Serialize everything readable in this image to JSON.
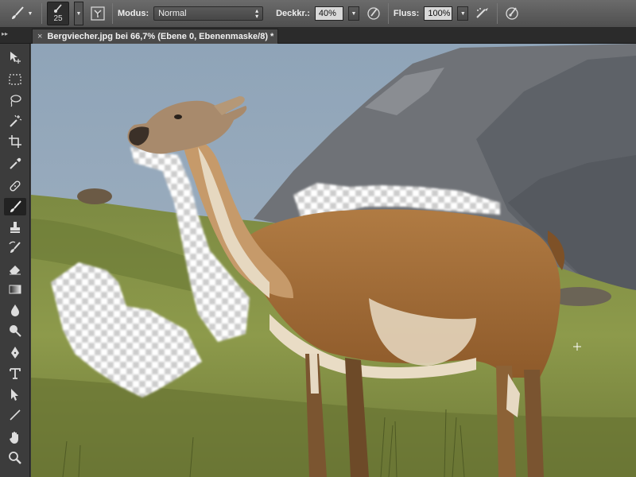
{
  "options_bar": {
    "brush_size": "25",
    "mode_label": "Modus:",
    "mode_value": "Normal",
    "opacity_label": "Deckkr.:",
    "opacity_value": "40%",
    "flow_label": "Fluss:",
    "flow_value": "100%"
  },
  "document": {
    "tab_title": "Bergviecher.jpg bei 66,7% (Ebene 0, Ebenenmaske/8) *",
    "close_glyph": "×"
  },
  "tabstrip": {
    "collapse_glyph": "▸▸"
  },
  "toolbox": {
    "active_tool": "brush-tool",
    "tools": [
      "move",
      "marquee",
      "lasso",
      "magic-wand",
      "crop",
      "eyedropper",
      "healing",
      "brush",
      "stamp",
      "history-brush",
      "eraser",
      "gradient",
      "blur",
      "dodge",
      "pen",
      "type",
      "path-selection",
      "line",
      "hand",
      "zoom"
    ]
  },
  "colors": {
    "ui_bar": "#5a5a5a",
    "ui_dark": "#2b2b2b",
    "sky": "#93a6b9",
    "mountain": "#6e7075",
    "grass": "#7d8a3e",
    "guanaco_fur": "#a46a35"
  }
}
